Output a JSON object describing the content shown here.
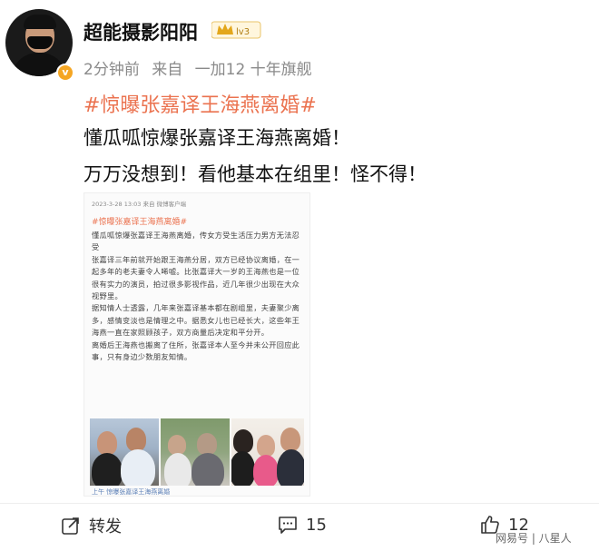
{
  "post": {
    "username": "超能摄影阳阳",
    "time": "2分钟前",
    "source": "来自",
    "device": "一加12 十年旗舰",
    "hashtag": "#惊曝张嘉译王海燕离婚#",
    "text_line1": "懂瓜呱惊爆张嘉译王海燕离婚！",
    "text_line2": "万万没想到！看他基本在组里！怪不得！"
  },
  "embedded_image": {
    "meta": "2023-3-28 13:03  来自 微博客户端",
    "hashtag": "#惊曝张嘉译王海燕离婚#",
    "paragraphs": [
      "懂瓜呱惊爆张嘉译王海燕离婚，传女方受生活压力男方无法忍受",
      "张嘉译三年前就开始跟王海燕分居，双方已经协议离婚，在一起多年的老夫妻令人唏嘘。比张嘉译大一岁的王海燕也是一位很有实力的演员，拍过很多影视作品，近几年很少出现在大众视野里。",
      "据知情人士透露，几年来张嘉译基本都在剧组里，夫妻聚少离多，感情变淡也是情理之中。据悉女儿也已经长大，这些年王海燕一直在家照顾孩子，双方商量后决定和平分开。",
      "离婚后王海燕也搬离了住所，张嘉译本人至今并未公开回应此事，只有身边少数朋友知情。"
    ],
    "footer": "上午 惊曝张嘉译王海燕离婚"
  },
  "actions": {
    "repost_label": "转发",
    "comment_count": "15",
    "like_count": "12"
  },
  "watermark": "网易号 | 八星人",
  "colors": {
    "hashtag": "#eb7350",
    "meta_gray": "#8a8a8a",
    "verified_badge": "#f5a623"
  }
}
